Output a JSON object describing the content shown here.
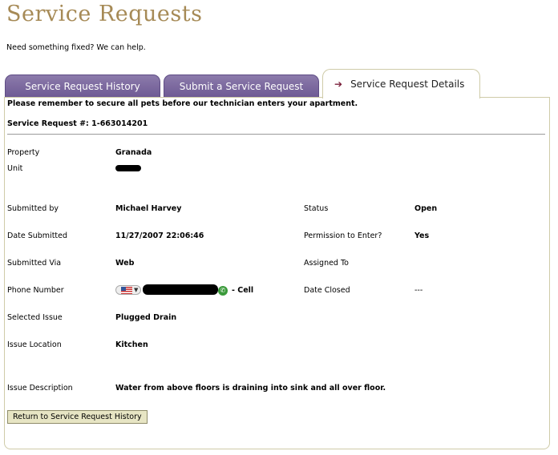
{
  "page": {
    "title": "Service Requests",
    "subtitle": "Need something fixed? We can help."
  },
  "tabs": [
    {
      "label": "Service Request History",
      "active": false
    },
    {
      "label": "Submit a Service Request",
      "active": false
    },
    {
      "label": "Service Request Details",
      "active": true
    }
  ],
  "details": {
    "notice": "Please remember to secure all pets before our technician enters your apartment.",
    "request_number": "Service Request #: 1-663014201",
    "property": {
      "label": "Property",
      "value": "Granada"
    },
    "unit": {
      "label": "Unit"
    },
    "submitted_by": {
      "label": "Submitted by",
      "value": "Michael Harvey"
    },
    "status": {
      "label": "Status",
      "value": "Open"
    },
    "date_submitted": {
      "label": "Date Submitted",
      "value": "11/27/2007 22:06:46"
    },
    "permission": {
      "label": "Permission to Enter?",
      "value": "Yes"
    },
    "submitted_via": {
      "label": "Submitted Via",
      "value": "Web"
    },
    "assigned_to": {
      "label": "Assigned To",
      "value": ""
    },
    "phone": {
      "label": "Phone Number",
      "suffix": "- Cell"
    },
    "date_closed": {
      "label": "Date Closed",
      "value": "---"
    },
    "selected_issue": {
      "label": "Selected Issue",
      "value": "Plugged Drain"
    },
    "issue_location": {
      "label": "Issue Location",
      "value": "Kitchen"
    },
    "issue_description": {
      "label": "Issue Description",
      "value": "Water from above floors is draining into sink and all over floor."
    }
  },
  "actions": {
    "back_label": "Return to Service Request History"
  },
  "colors": {
    "title": "#a68a56",
    "tab_inactive": "#6e5a94",
    "active_arrow": "#7a1f3a",
    "button_bg": "#e7e5c4"
  },
  "icons": [
    "arrow-right-icon",
    "us-flag-icon",
    "chevron-down-icon",
    "call-icon"
  ]
}
